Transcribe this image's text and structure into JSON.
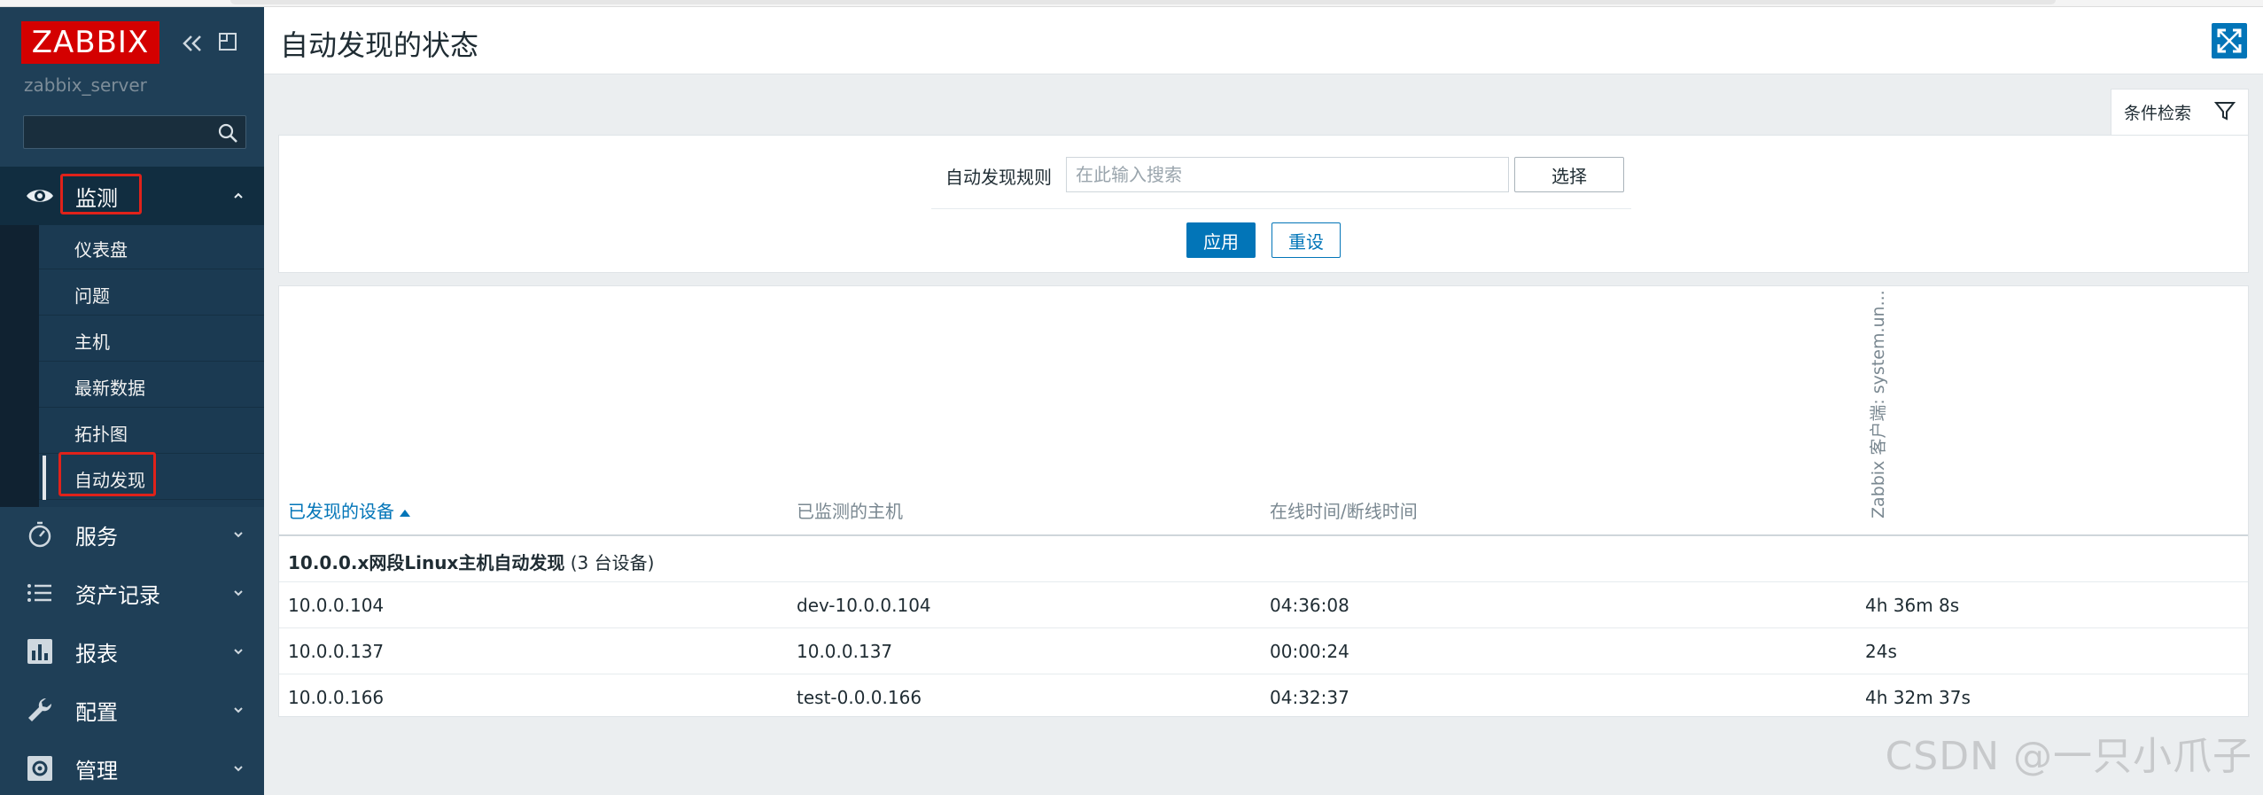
{
  "app": {
    "logo": "ZABBIX",
    "server_name": "zabbix_server"
  },
  "sidebar": {
    "sections": [
      {
        "label": "监测",
        "icon": "eye-icon",
        "expanded": true
      },
      {
        "label": "服务",
        "icon": "stopwatch-icon"
      },
      {
        "label": "资产记录",
        "icon": "list-icon"
      },
      {
        "label": "报表",
        "icon": "bar-chart-icon"
      },
      {
        "label": "配置",
        "icon": "wrench-icon"
      },
      {
        "label": "管理",
        "icon": "gear-icon"
      }
    ],
    "monitor_items": [
      "仪表盘",
      "问题",
      "主机",
      "最新数据",
      "拓扑图",
      "自动发现"
    ],
    "active_item": "自动发现"
  },
  "header": {
    "title": "自动发现的状态"
  },
  "filter": {
    "tab_label": "条件检索",
    "rule_label": "自动发现规则",
    "rule_placeholder": "在此输入搜索",
    "select_label": "选择",
    "apply_label": "应用",
    "reset_label": "重设"
  },
  "table": {
    "columns": [
      "已发现的设备",
      "已监测的主机",
      "在线时间/断线时间",
      "Zabbix 客户端: system.un..."
    ],
    "sorted_column": "已发现的设备",
    "group": {
      "name": "10.0.0.x网段Linux主机自动发现",
      "count_text": "(3 台设备)"
    },
    "rows": [
      {
        "device": "10.0.0.104",
        "host": "dev-10.0.0.104",
        "uptime": "04:36:08",
        "agent": "4h 36m 8s"
      },
      {
        "device": "10.0.0.137",
        "host": "10.0.0.137",
        "uptime": "00:00:24",
        "agent": "24s"
      },
      {
        "device": "10.0.0.166",
        "host": "test-0.0.0.166",
        "uptime": "04:32:37",
        "agent": "4h 32m 37s"
      }
    ]
  },
  "watermark": "CSDN @一只小爪子",
  "colors": {
    "sidebar_bg": "#1f3f57",
    "logo_bg": "#d40000",
    "accent": "#0275b8",
    "highlight_box": "#e0221a"
  }
}
